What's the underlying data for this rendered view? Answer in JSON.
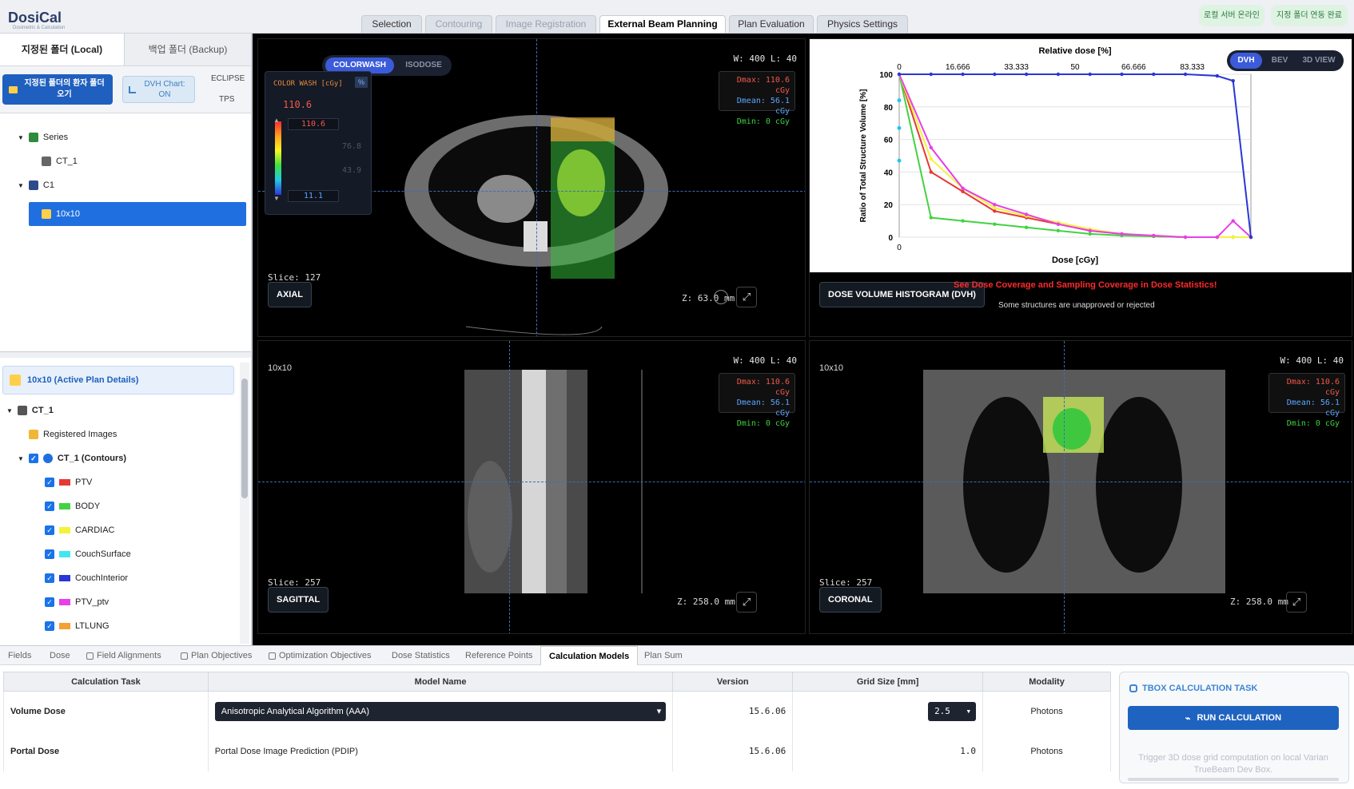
{
  "app": {
    "logo": "DosiCal",
    "logo_sub": "Dosimetric & Calculation"
  },
  "main_tabs": [
    {
      "label": "Selection",
      "state": "normal"
    },
    {
      "label": "Contouring",
      "state": "disabled"
    },
    {
      "label": "Image Registration",
      "state": "disabled"
    },
    {
      "label": "External Beam Planning",
      "state": "active"
    },
    {
      "label": "Plan Evaluation",
      "state": "normal"
    },
    {
      "label": "Physics Settings",
      "state": "normal"
    }
  ],
  "status_pills": [
    "로컬 서버 온라인",
    "지정 폴더 연동 완료"
  ],
  "left_panel": {
    "tabs": [
      "지정된 폴더 (Local)",
      "백업 폴더 (Backup)"
    ],
    "open_button": "지정된 폴더의 환자 폴더 오기",
    "dvh_toggle": "DVH Chart: ON",
    "eclipse": "ECLIPSE",
    "tps": "TPS",
    "tree": {
      "series": "Series",
      "ct": "CT_1",
      "course": "C1",
      "plan": "10x10"
    },
    "plan_header": "10x10 (Active Plan Details)",
    "ct_node": "CT_1",
    "registered": "Registered Images",
    "contours_node": "CT_1 (Contours)",
    "structures": [
      {
        "name": "PTV",
        "color": "#e53935"
      },
      {
        "name": "BODY",
        "color": "#43d243"
      },
      {
        "name": "CARDIAC",
        "color": "#f3f33a"
      },
      {
        "name": "CouchSurface",
        "color": "#43e6f0"
      },
      {
        "name": "CouchInterior",
        "color": "#2a36d6"
      },
      {
        "name": "PTV_ptv",
        "color": "#e83fe8"
      },
      {
        "name": "LTLUNG",
        "color": "#f4a132"
      }
    ]
  },
  "viewers": {
    "mode_toggle": [
      "COLORWASH",
      "ISODOSE"
    ],
    "wl": "W: 400 L: 40",
    "dose": {
      "dmax": "Dmax: 110.6 cGy",
      "dmean": "Dmean: 56.1 cGy",
      "dmin": "Dmin: 0 cGy"
    },
    "colorwash": {
      "title": "COLOR WASH [cGy]",
      "pct": "%",
      "current": "110.6",
      "max": "110.6",
      "mid1": "76.8",
      "mid2": "43.9",
      "min": "11.1"
    },
    "axial": {
      "label": "AXIAL",
      "slice": "Slice: 127",
      "z": "Z: 63.0 mm"
    },
    "sagittal": {
      "label": "SAGITTAL",
      "slice": "Slice: 257",
      "z": "Z: 258.0 mm",
      "plan": "10x10"
    },
    "coronal": {
      "label": "CORONAL",
      "slice": "Slice: 257",
      "z": "Z: 258.0 mm",
      "plan": "10x10"
    },
    "dvh": {
      "tabs": [
        "DVH",
        "BEV",
        "3D VIEW"
      ],
      "label": "DOSE VOLUME HISTOGRAM (DVH)",
      "warning": "See Dose Coverage and Sampling Coverage in Dose Statistics!",
      "note": "Some structures are unapproved or rejected"
    }
  },
  "chart_data": {
    "type": "line",
    "title": "Relative dose [%]",
    "xlabel": "Dose [cGy]",
    "ylabel": "Ratio of Total Structure Volume [%]",
    "top_ticks": [
      "0",
      "16.666",
      "33.333",
      "50",
      "66.666",
      "83.333"
    ],
    "y_ticks": [
      "0",
      "20",
      "40",
      "60",
      "80",
      "100"
    ],
    "x_tick_bottom": "0",
    "xlim": [
      0,
      110.6
    ],
    "ylim": [
      0,
      100
    ],
    "x": [
      0,
      10,
      20,
      30,
      40,
      50,
      60,
      70,
      80,
      90,
      100,
      105,
      110.6
    ],
    "series": [
      {
        "color": "#e53935",
        "values": [
          100,
          40,
          28,
          16,
          12,
          8,
          4,
          2,
          0.5,
          0,
          0,
          0,
          0
        ]
      },
      {
        "color": "#43d243",
        "values": [
          100,
          12,
          10,
          8,
          6,
          4,
          2,
          1,
          0.5,
          0,
          0,
          0,
          0
        ]
      },
      {
        "color": "#f3f33a",
        "values": [
          100,
          48,
          30,
          18,
          13,
          9,
          5,
          2,
          1,
          0,
          0,
          0,
          0
        ]
      },
      {
        "color": "#e83fe8",
        "values": [
          100,
          55,
          30,
          20,
          14,
          8,
          4,
          2,
          1,
          0,
          0,
          10,
          0
        ]
      },
      {
        "color": "#2a36d6",
        "values": [
          100,
          100,
          100,
          100,
          100,
          100,
          100,
          100,
          100,
          100,
          99,
          96,
          0
        ]
      }
    ]
  },
  "bottom": {
    "tabs": [
      "Fields",
      "Dose",
      "Field Alignments",
      "Plan Objectives",
      "Optimization Objectives",
      "Dose Statistics",
      "Reference Points",
      "Calculation Models",
      "Plan Sum"
    ],
    "headers": [
      "Calculation Task",
      "Model Name",
      "Version",
      "Grid Size [mm]",
      "Modality"
    ],
    "rows": [
      {
        "task": "Volume Dose",
        "model": "Anisotropic Analytical Algorithm (AAA)",
        "version": "15.6.06",
        "grid": "2.5",
        "modality": "Photons"
      },
      {
        "task": "Portal Dose",
        "model": "Portal Dose Image Prediction (PDIP)",
        "version": "15.6.06",
        "grid": "1.0",
        "modality": "Photons"
      }
    ],
    "tbox": {
      "title": "TBOX CALCULATION TASK",
      "button": "RUN CALCULATION",
      "note": "Trigger 3D dose grid computation on local Varian TrueBeam Dev Box."
    }
  }
}
